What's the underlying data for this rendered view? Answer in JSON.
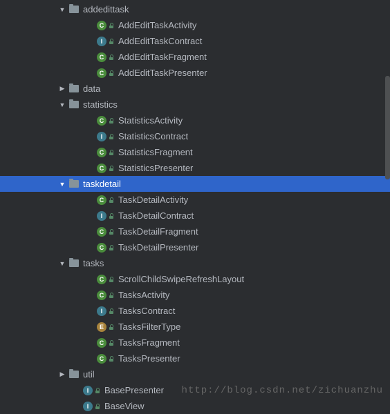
{
  "watermark": "http://blog.csdn.net/zichuanzhu",
  "tree": [
    {
      "indent": 85,
      "arrow": "down",
      "icon": "folder",
      "label": "addedittask"
    },
    {
      "indent": 125,
      "arrow": "blank",
      "icon": "class",
      "label": "AddEditTaskActivity"
    },
    {
      "indent": 125,
      "arrow": "blank",
      "icon": "interface",
      "label": "AddEditTaskContract"
    },
    {
      "indent": 125,
      "arrow": "blank",
      "icon": "class",
      "label": "AddEditTaskFragment"
    },
    {
      "indent": 125,
      "arrow": "blank",
      "icon": "class",
      "label": "AddEditTaskPresenter"
    },
    {
      "indent": 85,
      "arrow": "right",
      "icon": "folder",
      "label": "data"
    },
    {
      "indent": 85,
      "arrow": "down",
      "icon": "folder",
      "label": "statistics"
    },
    {
      "indent": 125,
      "arrow": "blank",
      "icon": "class",
      "label": "StatisticsActivity"
    },
    {
      "indent": 125,
      "arrow": "blank",
      "icon": "interface",
      "label": "StatisticsContract"
    },
    {
      "indent": 125,
      "arrow": "blank",
      "icon": "class",
      "label": "StatisticsFragment"
    },
    {
      "indent": 125,
      "arrow": "blank",
      "icon": "class",
      "label": "StatisticsPresenter"
    },
    {
      "indent": 85,
      "arrow": "down",
      "icon": "folder",
      "label": "taskdetail",
      "selected": true
    },
    {
      "indent": 125,
      "arrow": "blank",
      "icon": "class",
      "label": "TaskDetailActivity"
    },
    {
      "indent": 125,
      "arrow": "blank",
      "icon": "interface",
      "label": "TaskDetailContract"
    },
    {
      "indent": 125,
      "arrow": "blank",
      "icon": "class",
      "label": "TaskDetailFragment"
    },
    {
      "indent": 125,
      "arrow": "blank",
      "icon": "class",
      "label": "TaskDetailPresenter"
    },
    {
      "indent": 85,
      "arrow": "down",
      "icon": "folder",
      "label": "tasks"
    },
    {
      "indent": 125,
      "arrow": "blank",
      "icon": "class",
      "label": "ScrollChildSwipeRefreshLayout"
    },
    {
      "indent": 125,
      "arrow": "blank",
      "icon": "class",
      "label": "TasksActivity"
    },
    {
      "indent": 125,
      "arrow": "blank",
      "icon": "interface",
      "label": "TasksContract"
    },
    {
      "indent": 125,
      "arrow": "blank",
      "icon": "enum",
      "label": "TasksFilterType"
    },
    {
      "indent": 125,
      "arrow": "blank",
      "icon": "class",
      "label": "TasksFragment"
    },
    {
      "indent": 125,
      "arrow": "blank",
      "icon": "class",
      "label": "TasksPresenter"
    },
    {
      "indent": 85,
      "arrow": "right",
      "icon": "folder",
      "label": "util"
    },
    {
      "indent": 105,
      "arrow": "blank",
      "icon": "interface",
      "label": "BasePresenter"
    },
    {
      "indent": 105,
      "arrow": "blank",
      "icon": "interface",
      "label": "BaseView"
    }
  ]
}
